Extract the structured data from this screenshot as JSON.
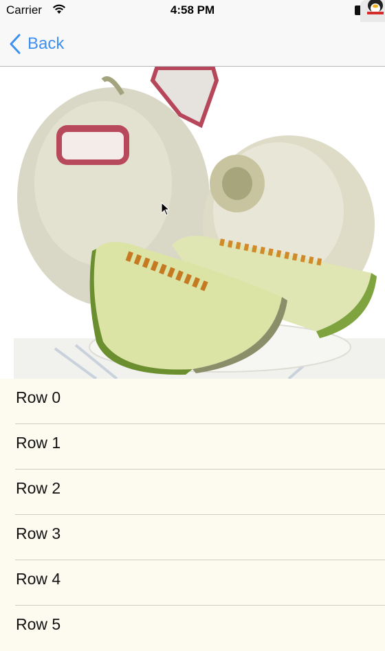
{
  "status_bar": {
    "carrier": "Carrier",
    "time": "4:58 PM"
  },
  "nav": {
    "back_label": "Back",
    "accent_color": "#3d8ff0"
  },
  "header_image": {
    "subject": "melon"
  },
  "table": {
    "background": "#fdfaef",
    "rows": [
      "Row 0",
      "Row 1",
      "Row 2",
      "Row 3",
      "Row 4",
      "Row 5"
    ]
  }
}
